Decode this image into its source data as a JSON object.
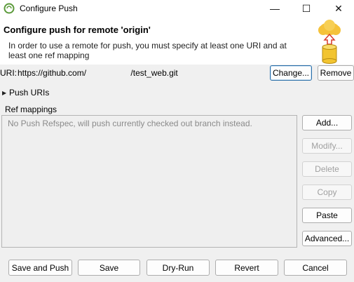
{
  "window": {
    "title": "Configure Push",
    "minimize_glyph": "—",
    "maximize_glyph": "☐",
    "close_glyph": "✕"
  },
  "header": {
    "title": "Configure push for remote 'origin'",
    "description": "In order to use a remote for push, you must specify at least one URI and at least one ref mapping"
  },
  "uri": {
    "label": "URI:",
    "value": "https://github.com/                   /test_web.git",
    "change_label": "Change...",
    "remove_label": "Remove"
  },
  "push_uris": {
    "label": "Push URIs",
    "expander_glyph": "▶"
  },
  "ref_mappings": {
    "label": "Ref mappings",
    "empty_text": "No Push Refspec, will push currently checked out branch instead.",
    "buttons": {
      "add": "Add...",
      "modify": "Modify...",
      "delete": "Delete",
      "copy": "Copy",
      "paste": "Paste",
      "advanced": "Advanced..."
    }
  },
  "footer": {
    "save_and_push": "Save and Push",
    "save": "Save",
    "dry_run": "Dry-Run",
    "revert": "Revert",
    "cancel": "Cancel"
  },
  "colors": {
    "accent_focus": "#2a6fa8",
    "disabled_text": "#a0a0a0",
    "app_icon": "#5b9a3a"
  },
  "icons": {
    "app": "eclipse-egit-icon",
    "header": "cloud-push-database-icon"
  }
}
